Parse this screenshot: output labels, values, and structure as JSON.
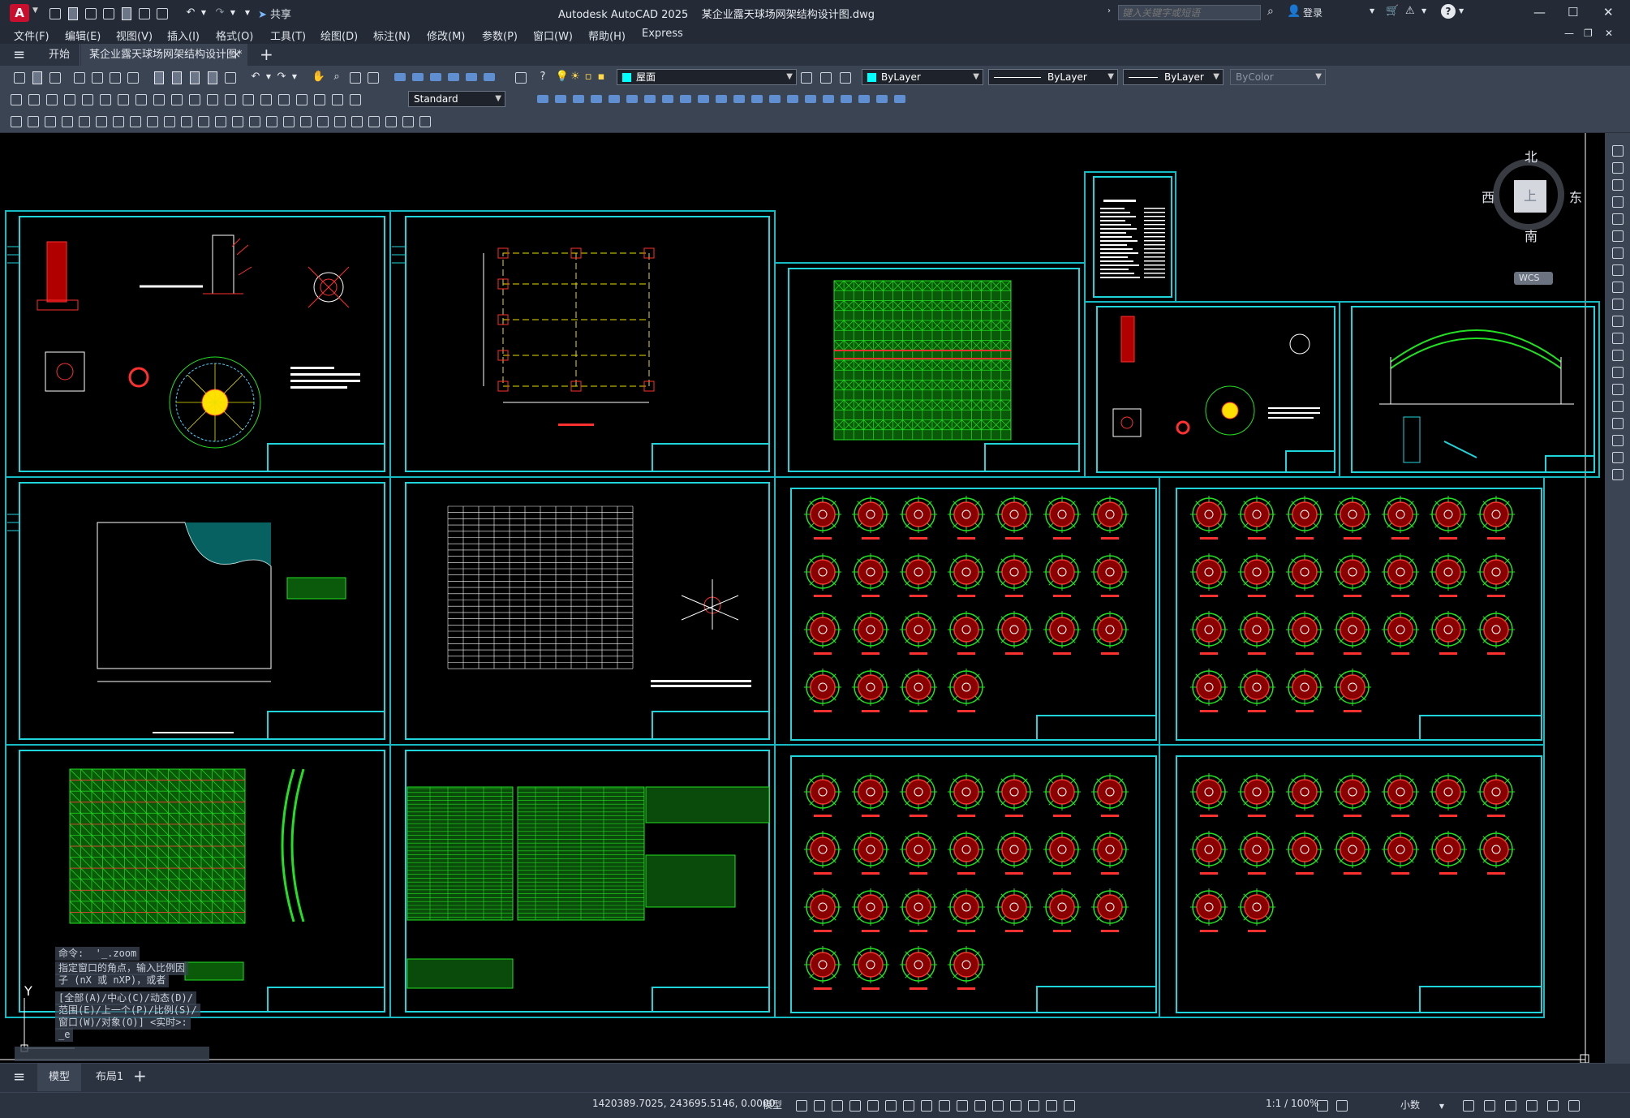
{
  "app": {
    "title": "Autodesk AutoCAD 2025",
    "filename": "某企业露天球场网架结构设计图.dwg",
    "logo": "A",
    "share": "共享",
    "search_placeholder": "键入关键字或短语",
    "login": "登录"
  },
  "menu": [
    "文件(F)",
    "编辑(E)",
    "视图(V)",
    "插入(I)",
    "格式(O)",
    "工具(T)",
    "绘图(D)",
    "标注(N)",
    "修改(M)",
    "参数(P)",
    "窗口(W)",
    "帮助(H)",
    "Express"
  ],
  "tabs": {
    "start": "开始",
    "doc": "某企业露天球场网架结构设计图*",
    "close": "×",
    "new": "+"
  },
  "toolbar": {
    "layer": "屋面",
    "color": "ByLayer",
    "linetype": "ByLayer",
    "lineweight": "ByLayer",
    "plotstyle": "ByColor",
    "textstyle": "Standard"
  },
  "viewcube": {
    "north": "北",
    "south": "南",
    "east": "东",
    "west": "西",
    "top": "上",
    "wcs": "WCS"
  },
  "command": {
    "line1": "命令:  '_.zoom",
    "line2": "指定窗口的角点，输入比例因",
    "line3": "子 (nX 或 nXP)，或者",
    "line4": "[全部(A)/中心(C)/动态(D)/",
    "line5": "范围(E)/上一个(P)/比例(S)/",
    "line6": "窗口(W)/对象(O)] <实时>:",
    "line7": "_e",
    "ucs_y": "Y"
  },
  "layouts": {
    "model": "模型",
    "layout1": "布局1",
    "add": "+"
  },
  "status": {
    "coords": "1420389.7025, 243695.5146, 0.0000",
    "mode": "模型",
    "scale": "1:1 / 100%",
    "units": "小数"
  },
  "colors": {
    "accent": "#17b9c2",
    "green": "#22e022",
    "red": "#ff2020",
    "yellow": "#e8e000",
    "white": "#ffffff"
  }
}
